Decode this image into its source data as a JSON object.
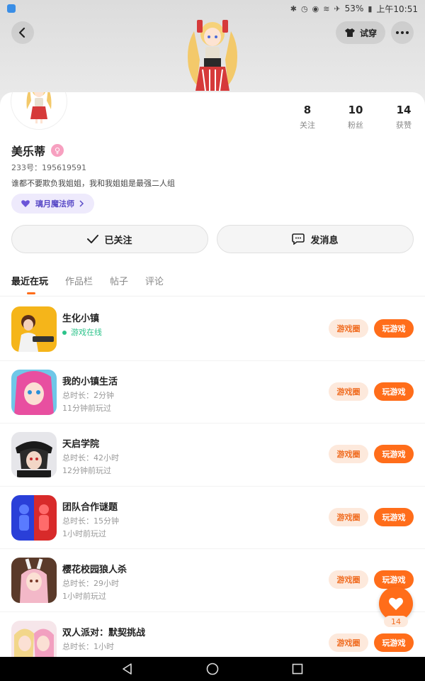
{
  "status_bar": {
    "battery": "53%",
    "time": "上午10:51"
  },
  "header": {
    "tryon_label": "试穿"
  },
  "profile": {
    "name": "美乐蒂",
    "uid": "233号：195619591",
    "bio": "谁都不要欺负我姐姐，我和我姐姐是最强二人组",
    "title_tag": "璃月魔法师"
  },
  "stats": [
    {
      "value": "8",
      "label": "关注"
    },
    {
      "value": "10",
      "label": "粉丝"
    },
    {
      "value": "14",
      "label": "获赞"
    }
  ],
  "actions": {
    "followed": "已关注",
    "message": "发消息"
  },
  "tabs": [
    "最近在玩",
    "作品栏",
    "帖子",
    "评论"
  ],
  "games": [
    {
      "name": "生化小镇",
      "line1": "游戏在线",
      "line2": "",
      "online": true
    },
    {
      "name": "我的小镇生活",
      "line1": "总时长：2分钟",
      "line2": "11分钟前玩过"
    },
    {
      "name": "天启学院",
      "line1": "总时长：42小时",
      "line2": "12分钟前玩过"
    },
    {
      "name": "团队合作谜题",
      "line1": "总时长：15分钟",
      "line2": "1小时前玩过"
    },
    {
      "name": "樱花校园狼人杀",
      "line1": "总时长：29小时",
      "line2": "1小时前玩过"
    },
    {
      "name": "双人派对：默契挑战",
      "line1": "总时长：1小时",
      "line2": ""
    }
  ],
  "game_buttons": {
    "circle": "游戏圈",
    "play": "玩游戏"
  },
  "fab": {
    "count": "14"
  },
  "colors": {
    "accent": "#ff6d1a",
    "accent_light": "#fde9dc",
    "online": "#2cc38a",
    "tag": "#5a4bc7"
  }
}
